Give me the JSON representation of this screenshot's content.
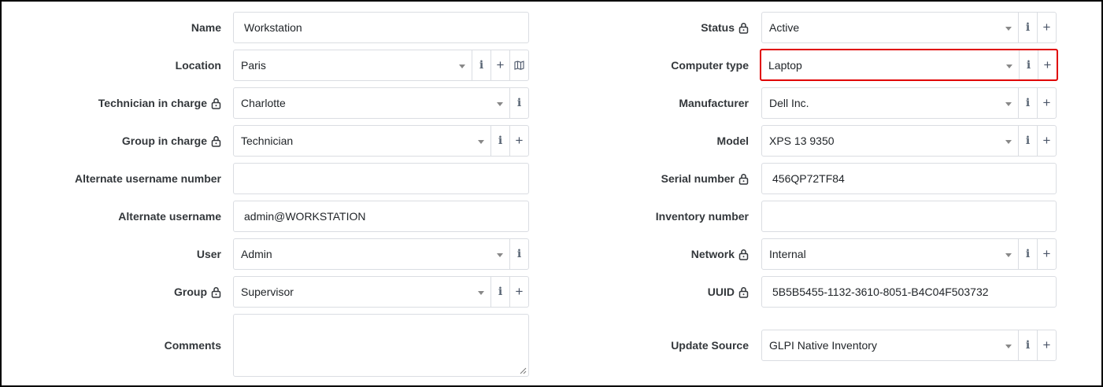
{
  "left": {
    "name": {
      "label": "Name",
      "value": "Workstation"
    },
    "location": {
      "label": "Location",
      "value": "Paris"
    },
    "technician": {
      "label": "Technician in charge",
      "value": "Charlotte"
    },
    "group_in_charge": {
      "label": "Group in charge",
      "value": "Technician"
    },
    "alt_username_number": {
      "label": "Alternate username number",
      "value": ""
    },
    "alt_username": {
      "label": "Alternate username",
      "value": "admin@WORKSTATION"
    },
    "user": {
      "label": "User",
      "value": "Admin"
    },
    "group": {
      "label": "Group",
      "value": "Supervisor"
    },
    "comments": {
      "label": "Comments",
      "value": ""
    }
  },
  "right": {
    "status": {
      "label": "Status",
      "value": "Active"
    },
    "computer_type": {
      "label": "Computer type",
      "value": "Laptop"
    },
    "manufacturer": {
      "label": "Manufacturer",
      "value": "Dell Inc."
    },
    "model": {
      "label": "Model",
      "value": "XPS 13 9350"
    },
    "serial": {
      "label": "Serial number",
      "value": "456QP72TF84"
    },
    "inventory": {
      "label": "Inventory number",
      "value": ""
    },
    "network": {
      "label": "Network",
      "value": "Internal"
    },
    "uuid": {
      "label": "UUID",
      "value": "5B5B5455-1132-3610-8051-B4C04F503732"
    },
    "update_source": {
      "label": "Update Source",
      "value": "GLPI Native Inventory"
    }
  },
  "icons": {
    "info": "i",
    "plus": "+",
    "lock": "lock-icon",
    "map": "map-icon",
    "dropdown": "chevron-down-icon"
  },
  "colors": {
    "highlight": "#e00000",
    "border": "#dadde2"
  }
}
